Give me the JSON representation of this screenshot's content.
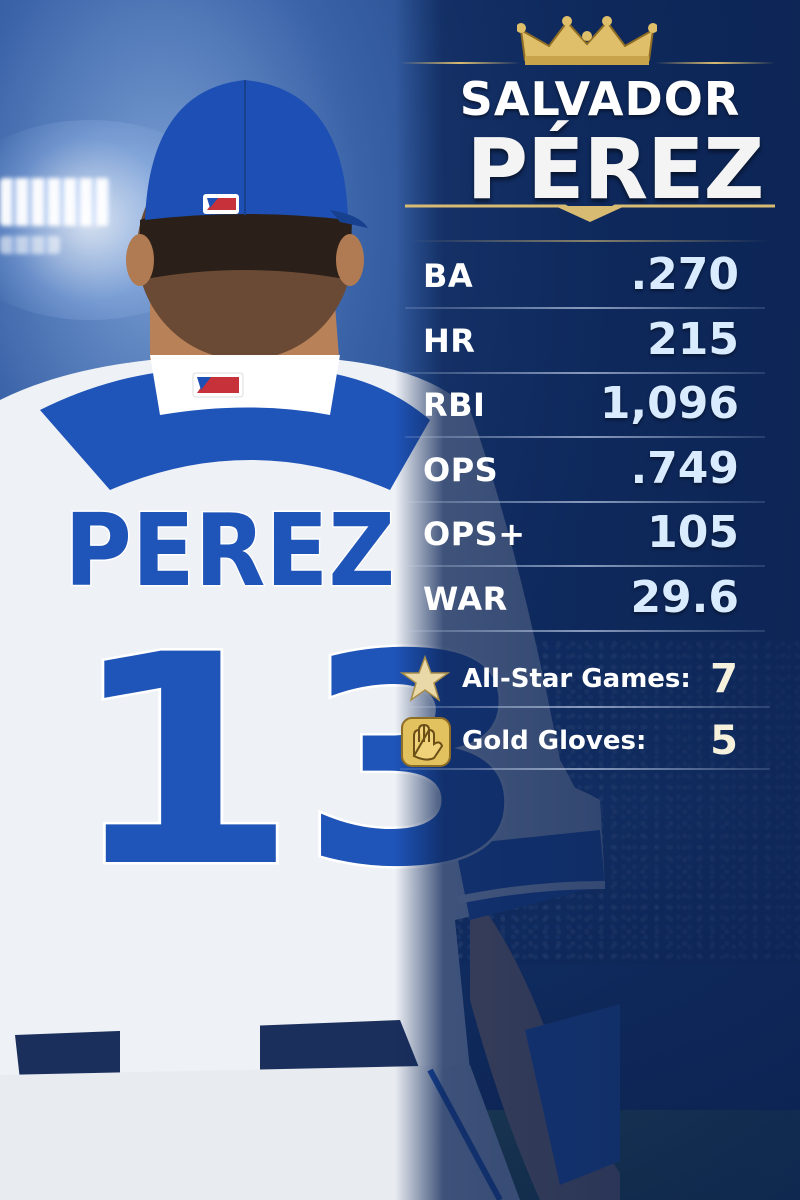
{
  "player": {
    "first_name": "SALVADOR",
    "last_name": "PÉREZ",
    "jersey_name": "PEREZ",
    "jersey_number": "13"
  },
  "stats": [
    {
      "label": "BA",
      "value": ".270"
    },
    {
      "label": "HR",
      "value": "215"
    },
    {
      "label": "RBI",
      "value": "1,096"
    },
    {
      "label": "OPS",
      "value": ".749"
    },
    {
      "label": "OPS+",
      "value": "105"
    },
    {
      "label": "WAR",
      "value": "29.6"
    }
  ],
  "awards": [
    {
      "label": "All-Star Games:",
      "value": "7",
      "icon": "star-icon"
    },
    {
      "label": "Gold Gloves:",
      "value": "5",
      "icon": "gold-glove-icon"
    }
  ],
  "icons": {
    "crown": "crown-icon",
    "logo": "mlb-logo"
  },
  "colors": {
    "royal_blue": "#1f54b8",
    "navy": "#0d2a5c",
    "gold": "#d8bb72",
    "white": "#ffffff"
  }
}
